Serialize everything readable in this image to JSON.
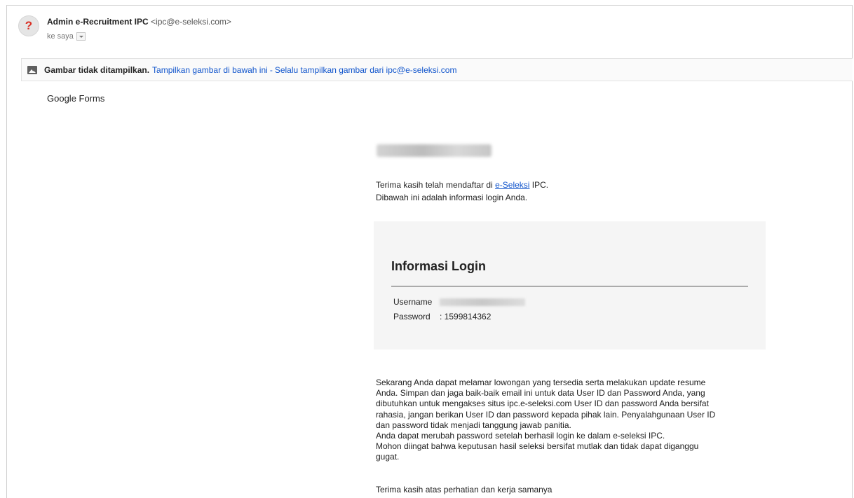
{
  "email": {
    "avatar_glyph": "?",
    "sender_name": "Admin e-Recruitment IPC",
    "sender_email": "<ipc@e-seleksi.com>",
    "recipient": "ke saya",
    "images_notice": {
      "bold": "Gambar tidak ditampilkan.",
      "show_link": "Tampilkan gambar di bawah ini",
      "separator": "-",
      "always_link": "Selalu tampilkan gambar dari ipc@e-seleksi.com"
    },
    "forms_label": "Google Forms"
  },
  "message": {
    "intro_prefix": "Terima kasih telah mendaftar di ",
    "intro_link": "e-Seleksi",
    "intro_suffix": " IPC.",
    "intro_line2": "Dibawah ini adalah informasi login Anda.",
    "login": {
      "title": "Informasi Login",
      "username_label": "Username",
      "password_label": "Password",
      "password_value": ": 1599814362"
    },
    "paragraph_lines": [
      "Sekarang Anda dapat melamar lowongan yang tersedia serta melakukan update resume",
      "Anda. Simpan dan jaga baik-baik email ini untuk data User ID dan Password Anda, yang",
      "dibutuhkan untuk mengakses situs ipc.e-seleksi.com User ID dan password Anda bersifat",
      "rahasia, jangan berikan User ID dan password kepada pihak lain. Penyalahgunaan User ID",
      "dan password tidak menjadi tanggung jawab panitia.",
      "Anda dapat merubah password setelah berhasil login ke dalam e-seleksi IPC.",
      "Mohon diingat bahwa keputusan hasil seleksi bersifat mutlak dan tidak dapat diganggu",
      "gugat."
    ],
    "closing": "Terima kasih atas perhatian dan kerja samanya"
  },
  "colors": {
    "link": "#1155cc",
    "avatar_mark": "#d93025",
    "login_box_bg": "#f5f5f5"
  },
  "icons": {
    "avatar": "unknown-sender-icon",
    "images_bar": "image-icon",
    "recipient_toggle": "dropdown-arrow-icon"
  }
}
